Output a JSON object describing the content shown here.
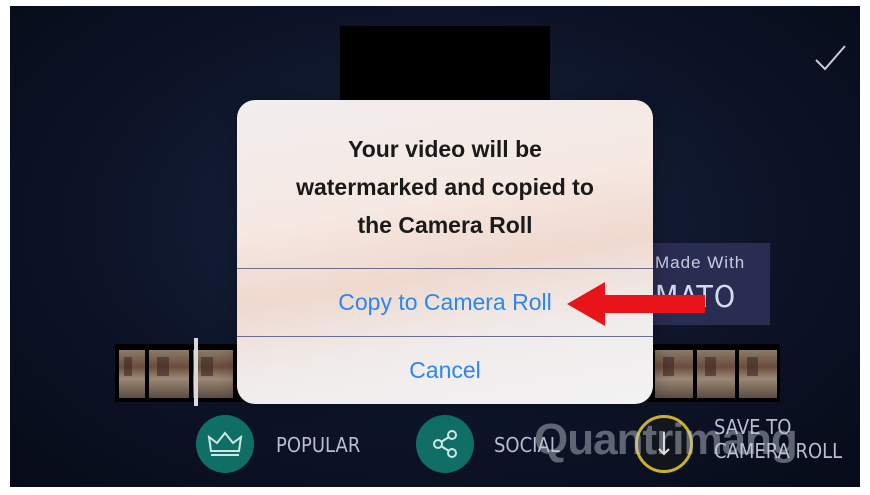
{
  "alert": {
    "message_lines": [
      "Your video will be",
      "watermarked and copied to",
      "the Camera Roll"
    ],
    "primary_button": "Copy to Camera Roll",
    "cancel_button": "Cancel"
  },
  "watermark_badge": {
    "line1": "Made With",
    "line2": "MATO"
  },
  "bottom_bar": {
    "popular_label": "POPULAR",
    "social_label": "SOCIAL",
    "save_label_line1": "SAVE TO",
    "save_label_line2": "CAMERA ROLL"
  },
  "brand_watermark": "Quantrimang",
  "icons": {
    "done": "checkmark-icon",
    "popular": "crown-icon",
    "social": "share-icon",
    "save": "download-icon",
    "annotation": "red-arrow-icon"
  },
  "colors": {
    "alert_button_text": "#2b87ee",
    "annotation_arrow": "#e8141a",
    "popular_circle": "#0f6f67",
    "save_circle_border": "#c9b12a"
  }
}
